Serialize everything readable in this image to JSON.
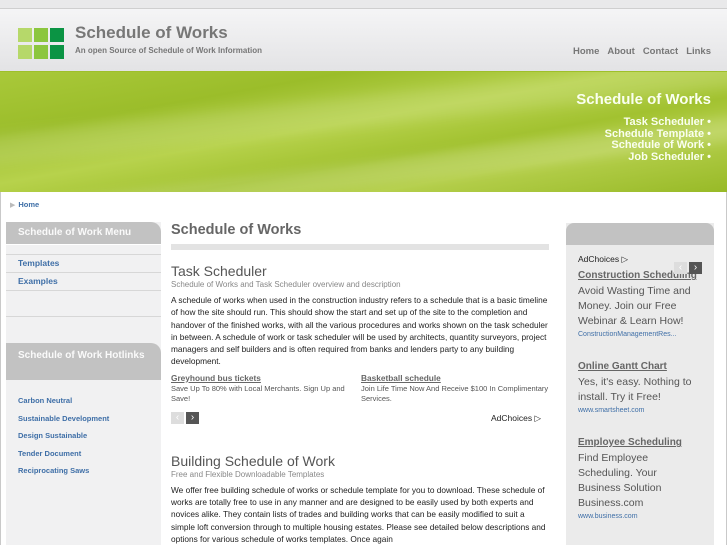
{
  "header": {
    "site_title": "Schedule of Works",
    "site_subtitle": "An open Source of Schedule of Work Information",
    "nav": [
      "Home",
      "About",
      "Contact",
      "Links"
    ],
    "logo_colors": [
      "#b6d86a",
      "#8cc63e",
      "#0b9444",
      "#b6d86a",
      "#8cc63e",
      "#0b9444"
    ]
  },
  "banner": {
    "title": "Schedule of Works",
    "links": [
      "Task Scheduler",
      "Schedule Template",
      "Schedule of Work",
      "Job Scheduler"
    ]
  },
  "breadcrumb": {
    "home": "Home"
  },
  "left_sidebar": {
    "menu_title": "Schedule of Work Menu",
    "menu_items": [
      "Templates",
      "Examples"
    ],
    "hotlinks_title": "Schedule of Work Hotlinks",
    "hotlinks": [
      "Carbon Neutral",
      "Sustainable Development",
      "Design Sustainable",
      "Tender Document",
      "Reciprocating Saws"
    ]
  },
  "main": {
    "title": "Schedule of Works",
    "sections": [
      {
        "title": "Task Scheduler",
        "subtitle": "Schedule of Works and Task Scheduler overview and description",
        "body": "A schedule of works when used in the construction industry refers to a schedule that is a basic timeline of how the site should run. This should show the start and set up of the site to the completion and handover of the finished works, with all the various procedures and works shown on the task scheduler in between. A schedule of work or task scheduler will be used by architects, quantity surveyors, project managers and self builders and is often required from banks and lenders party to any building development."
      },
      {
        "title": "Building Schedule of Work",
        "subtitle": "Free and Flexible Downloadable Templates",
        "body": "We offer free building schedule of works or schedule template for you to download. These schedule of works are totally free to use in any manner and are designed to be easily used by both experts and novices alike. They contain lists of trades and building works that can be easily modified to suit a simple loft conversion through to multiple housing estates. Please see detailed below descriptions and options for various schedule of works templates. Once again"
      }
    ],
    "ads": [
      {
        "title": "Greyhound bus tickets",
        "desc": "Save Up To 80% with Local Merchants. Sign Up and Save!"
      },
      {
        "title": "Basketball schedule",
        "desc": "Join Life Time Now And Receive $100 In Complimentary Services."
      }
    ],
    "adchoices": "AdChoices ▷",
    "prev_glyph": "‹",
    "next_glyph": "›"
  },
  "right_sidebar": {
    "adchoices": "AdChoices ▷",
    "ads": [
      {
        "title": "Construction Scheduling",
        "desc": "Avoid Wasting Time and Money. Join our Free Webinar & Learn How!",
        "url": "ConstructionManagementRes..."
      },
      {
        "title": "Online Gantt Chart",
        "desc": "Yes, it's easy. Nothing to install. Try it Free!",
        "url": "www.smartsheet.com"
      },
      {
        "title": "Employee Scheduling",
        "desc": "Find Employee Scheduling. Your Business Solution Business.com",
        "url": "www.business.com"
      }
    ]
  }
}
